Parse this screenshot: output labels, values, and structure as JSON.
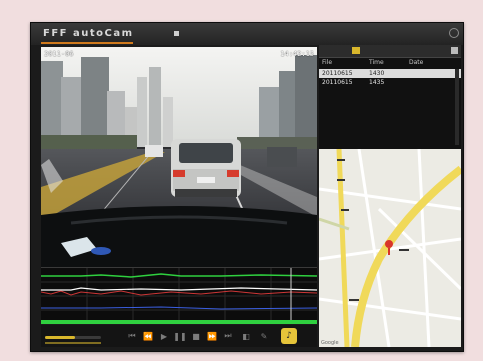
{
  "app": {
    "title": "FFF autoCam",
    "accent_color": "#d07a1d",
    "icons": [
      "close-icon",
      "menu-dot-icon"
    ]
  },
  "video": {
    "osd_left": "2011-06",
    "osd_right": "14:42:15",
    "scene": "dashcam road view"
  },
  "controls": {
    "buttons": [
      "prev-icon",
      "rewind-icon",
      "play-icon",
      "pause-icon",
      "stop-icon",
      "forward-icon",
      "next-icon",
      "snapshot-icon",
      "settings-icon"
    ],
    "volume_icon": "speaker-icon",
    "seek_progress": 0.54
  },
  "gsensor_graph": {
    "series_colors": [
      "#2fd03f",
      "#ffffff",
      "#e23b3b",
      "#3b5fe2"
    ],
    "grid": true
  },
  "file_panel": {
    "columns": [
      "File",
      "Time",
      "Date"
    ],
    "rows": [
      {
        "file": "20110615",
        "time": "1430",
        "selected": true
      },
      {
        "file": "20110615",
        "time": "1435",
        "selected": false
      }
    ]
  },
  "map": {
    "credit": "Google"
  }
}
